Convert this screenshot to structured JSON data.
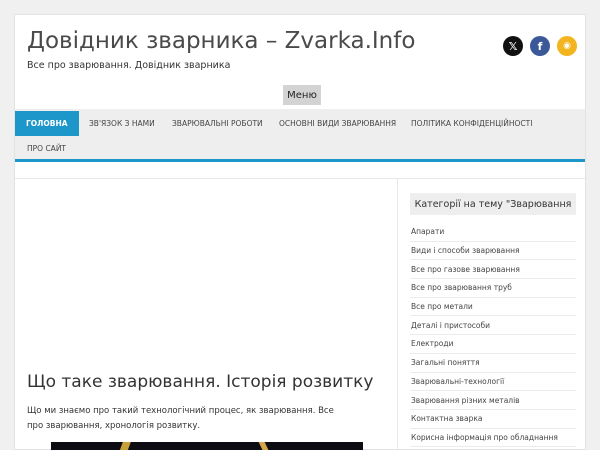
{
  "site": {
    "title": "Довідник зварника – Zvarka.Info",
    "description": "Все про зварювання. Довідник зварника",
    "menu_button": "Меню"
  },
  "social": {
    "x": "𝕏",
    "facebook": "f",
    "rss": "◉"
  },
  "nav": {
    "items": [
      {
        "label": "ГОЛОВНА"
      },
      {
        "label": "ЗВ'ЯЗОК З НАМИ"
      },
      {
        "label": "ЗВАРЮВАЛЬНІ РОБОТИ"
      },
      {
        "label": "ОСНОВНІ ВИДИ ЗВАРЮВАННЯ"
      },
      {
        "label": "ПОЛІТИКА КОНФІДЕНЦІЙНОСТІ"
      },
      {
        "label": "ПРО САЙТ"
      }
    ],
    "active_color": "#1d96c9"
  },
  "post": {
    "title": "Що таке зварювання. Історія розвитку",
    "excerpt": "Що ми знаємо про такий технологічний процес, як зварювання. Все про зварювання, хронологія розвитку."
  },
  "sidebar": {
    "widget_title": "Категорії на тему \"Зварювання",
    "categories": [
      "Апарати",
      "Види і способи зварювання",
      "Все про газове зварювання",
      "Все про зварювання труб",
      "Все про метали",
      "Деталі і пристособи",
      "Електроди",
      "Загальні поняття",
      "Зварювальні-технології",
      "Зварювання різних металів",
      "Контактна зварка",
      "Корисна інформація про обладнання"
    ]
  }
}
